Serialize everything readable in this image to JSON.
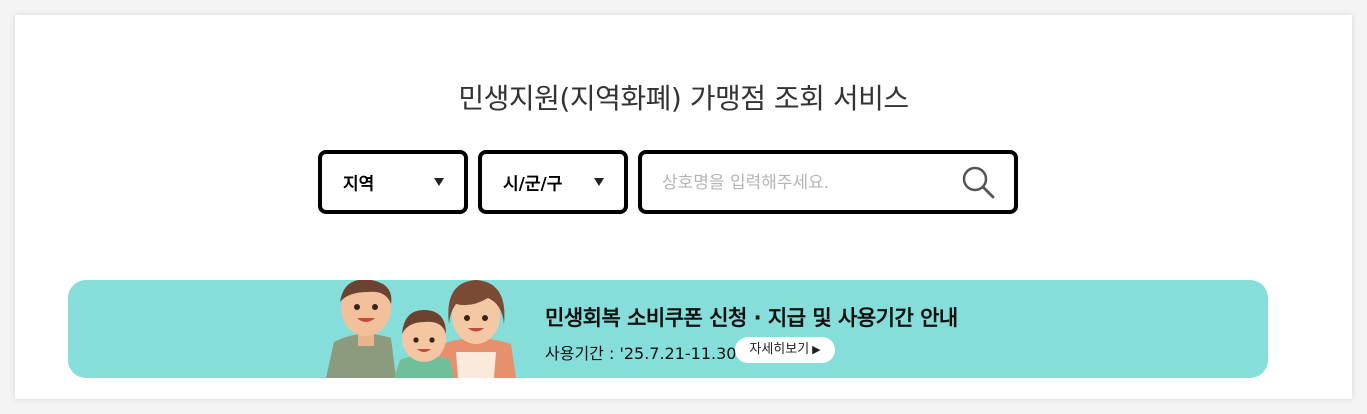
{
  "page": {
    "title": "민생지원(지역화폐) 가맹점 조회 서비스"
  },
  "filters": {
    "region": {
      "selected": "지역",
      "icon": "triangle-down-icon"
    },
    "district": {
      "selected": "시/군/구",
      "icon": "triangle-down-icon"
    }
  },
  "search": {
    "value": "",
    "placeholder": "상호명을 입력해주세요.",
    "icon": "search-icon"
  },
  "banner": {
    "title": "민생회복 소비쿠폰 신청 · 지급 및 사용기간 안내",
    "period": "사용기간 : '25.7.21-11.30",
    "button_label": "자세히보기",
    "button_arrow": "▶",
    "background": "#86dedb"
  }
}
